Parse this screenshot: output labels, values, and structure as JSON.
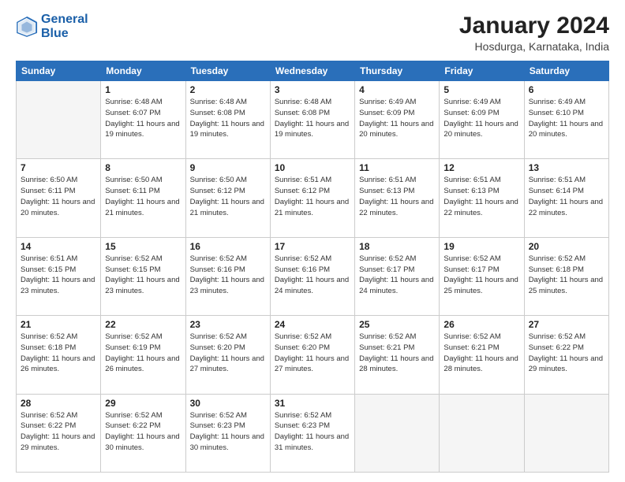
{
  "logo": {
    "line1": "General",
    "line2": "Blue"
  },
  "title": "January 2024",
  "location": "Hosdurga, Karnataka, India",
  "weekdays": [
    "Sunday",
    "Monday",
    "Tuesday",
    "Wednesday",
    "Thursday",
    "Friday",
    "Saturday"
  ],
  "days": [
    {
      "num": "",
      "sunrise": "",
      "sunset": "",
      "daylight": ""
    },
    {
      "num": "1",
      "sunrise": "Sunrise: 6:48 AM",
      "sunset": "Sunset: 6:07 PM",
      "daylight": "Daylight: 11 hours and 19 minutes."
    },
    {
      "num": "2",
      "sunrise": "Sunrise: 6:48 AM",
      "sunset": "Sunset: 6:08 PM",
      "daylight": "Daylight: 11 hours and 19 minutes."
    },
    {
      "num": "3",
      "sunrise": "Sunrise: 6:48 AM",
      "sunset": "Sunset: 6:08 PM",
      "daylight": "Daylight: 11 hours and 19 minutes."
    },
    {
      "num": "4",
      "sunrise": "Sunrise: 6:49 AM",
      "sunset": "Sunset: 6:09 PM",
      "daylight": "Daylight: 11 hours and 20 minutes."
    },
    {
      "num": "5",
      "sunrise": "Sunrise: 6:49 AM",
      "sunset": "Sunset: 6:09 PM",
      "daylight": "Daylight: 11 hours and 20 minutes."
    },
    {
      "num": "6",
      "sunrise": "Sunrise: 6:49 AM",
      "sunset": "Sunset: 6:10 PM",
      "daylight": "Daylight: 11 hours and 20 minutes."
    },
    {
      "num": "7",
      "sunrise": "Sunrise: 6:50 AM",
      "sunset": "Sunset: 6:11 PM",
      "daylight": "Daylight: 11 hours and 20 minutes."
    },
    {
      "num": "8",
      "sunrise": "Sunrise: 6:50 AM",
      "sunset": "Sunset: 6:11 PM",
      "daylight": "Daylight: 11 hours and 21 minutes."
    },
    {
      "num": "9",
      "sunrise": "Sunrise: 6:50 AM",
      "sunset": "Sunset: 6:12 PM",
      "daylight": "Daylight: 11 hours and 21 minutes."
    },
    {
      "num": "10",
      "sunrise": "Sunrise: 6:51 AM",
      "sunset": "Sunset: 6:12 PM",
      "daylight": "Daylight: 11 hours and 21 minutes."
    },
    {
      "num": "11",
      "sunrise": "Sunrise: 6:51 AM",
      "sunset": "Sunset: 6:13 PM",
      "daylight": "Daylight: 11 hours and 22 minutes."
    },
    {
      "num": "12",
      "sunrise": "Sunrise: 6:51 AM",
      "sunset": "Sunset: 6:13 PM",
      "daylight": "Daylight: 11 hours and 22 minutes."
    },
    {
      "num": "13",
      "sunrise": "Sunrise: 6:51 AM",
      "sunset": "Sunset: 6:14 PM",
      "daylight": "Daylight: 11 hours and 22 minutes."
    },
    {
      "num": "14",
      "sunrise": "Sunrise: 6:51 AM",
      "sunset": "Sunset: 6:15 PM",
      "daylight": "Daylight: 11 hours and 23 minutes."
    },
    {
      "num": "15",
      "sunrise": "Sunrise: 6:52 AM",
      "sunset": "Sunset: 6:15 PM",
      "daylight": "Daylight: 11 hours and 23 minutes."
    },
    {
      "num": "16",
      "sunrise": "Sunrise: 6:52 AM",
      "sunset": "Sunset: 6:16 PM",
      "daylight": "Daylight: 11 hours and 23 minutes."
    },
    {
      "num": "17",
      "sunrise": "Sunrise: 6:52 AM",
      "sunset": "Sunset: 6:16 PM",
      "daylight": "Daylight: 11 hours and 24 minutes."
    },
    {
      "num": "18",
      "sunrise": "Sunrise: 6:52 AM",
      "sunset": "Sunset: 6:17 PM",
      "daylight": "Daylight: 11 hours and 24 minutes."
    },
    {
      "num": "19",
      "sunrise": "Sunrise: 6:52 AM",
      "sunset": "Sunset: 6:17 PM",
      "daylight": "Daylight: 11 hours and 25 minutes."
    },
    {
      "num": "20",
      "sunrise": "Sunrise: 6:52 AM",
      "sunset": "Sunset: 6:18 PM",
      "daylight": "Daylight: 11 hours and 25 minutes."
    },
    {
      "num": "21",
      "sunrise": "Sunrise: 6:52 AM",
      "sunset": "Sunset: 6:18 PM",
      "daylight": "Daylight: 11 hours and 26 minutes."
    },
    {
      "num": "22",
      "sunrise": "Sunrise: 6:52 AM",
      "sunset": "Sunset: 6:19 PM",
      "daylight": "Daylight: 11 hours and 26 minutes."
    },
    {
      "num": "23",
      "sunrise": "Sunrise: 6:52 AM",
      "sunset": "Sunset: 6:20 PM",
      "daylight": "Daylight: 11 hours and 27 minutes."
    },
    {
      "num": "24",
      "sunrise": "Sunrise: 6:52 AM",
      "sunset": "Sunset: 6:20 PM",
      "daylight": "Daylight: 11 hours and 27 minutes."
    },
    {
      "num": "25",
      "sunrise": "Sunrise: 6:52 AM",
      "sunset": "Sunset: 6:21 PM",
      "daylight": "Daylight: 11 hours and 28 minutes."
    },
    {
      "num": "26",
      "sunrise": "Sunrise: 6:52 AM",
      "sunset": "Sunset: 6:21 PM",
      "daylight": "Daylight: 11 hours and 28 minutes."
    },
    {
      "num": "27",
      "sunrise": "Sunrise: 6:52 AM",
      "sunset": "Sunset: 6:22 PM",
      "daylight": "Daylight: 11 hours and 29 minutes."
    },
    {
      "num": "28",
      "sunrise": "Sunrise: 6:52 AM",
      "sunset": "Sunset: 6:22 PM",
      "daylight": "Daylight: 11 hours and 29 minutes."
    },
    {
      "num": "29",
      "sunrise": "Sunrise: 6:52 AM",
      "sunset": "Sunset: 6:22 PM",
      "daylight": "Daylight: 11 hours and 30 minutes."
    },
    {
      "num": "30",
      "sunrise": "Sunrise: 6:52 AM",
      "sunset": "Sunset: 6:23 PM",
      "daylight": "Daylight: 11 hours and 30 minutes."
    },
    {
      "num": "31",
      "sunrise": "Sunrise: 6:52 AM",
      "sunset": "Sunset: 6:23 PM",
      "daylight": "Daylight: 11 hours and 31 minutes."
    }
  ]
}
